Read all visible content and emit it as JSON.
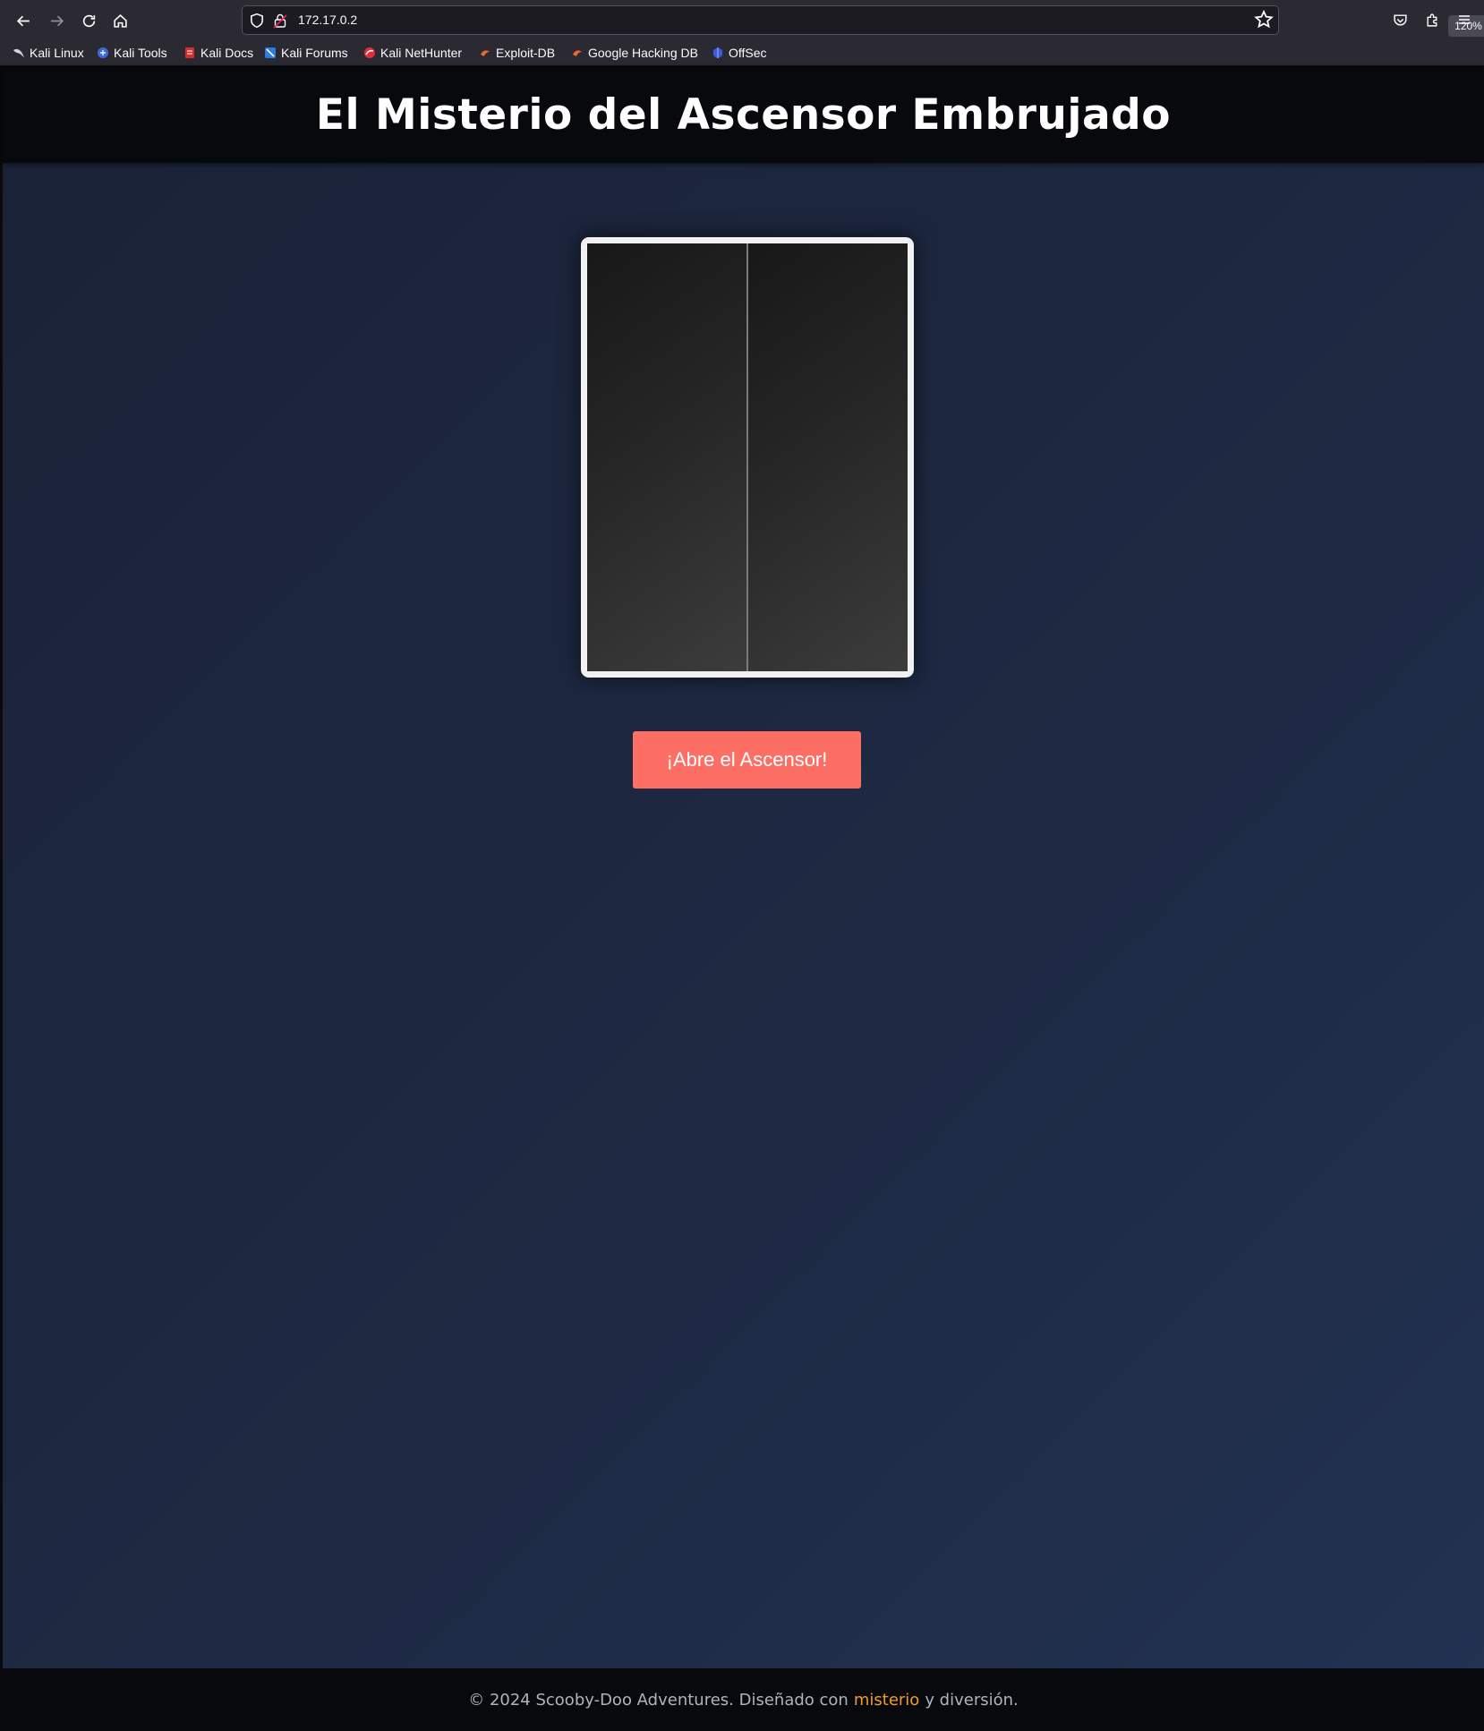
{
  "browser": {
    "url": "172.17.0.2",
    "zoom": "120%",
    "bookmarks": [
      {
        "label": "Kali Linux",
        "icon": "kali-dragon-icon"
      },
      {
        "label": "Kali Tools",
        "icon": "kali-tools-icon"
      },
      {
        "label": "Kali Docs",
        "icon": "kali-docs-icon"
      },
      {
        "label": "Kali Forums",
        "icon": "kali-forums-icon"
      },
      {
        "label": "Kali NetHunter",
        "icon": "kali-nethunter-icon"
      },
      {
        "label": "Exploit-DB",
        "icon": "exploit-db-icon"
      },
      {
        "label": "Google Hacking DB",
        "icon": "ghdb-icon"
      },
      {
        "label": "OffSec",
        "icon": "offsec-icon"
      }
    ]
  },
  "header": {
    "title": "El Misterio del Ascensor Embrujado"
  },
  "main": {
    "open_button_label": "¡Abre el Ascensor!"
  },
  "footer": {
    "text_before": "© 2024 Scooby-Doo Adventures. Diseñado con",
    "highlight": "misterio",
    "text_after": "y diversión."
  },
  "colors": {
    "accent_button": "#fd6f64",
    "footer_highlight": "#f39c22",
    "header_bg": "#07090d",
    "page_bg": "#1e2a44"
  }
}
